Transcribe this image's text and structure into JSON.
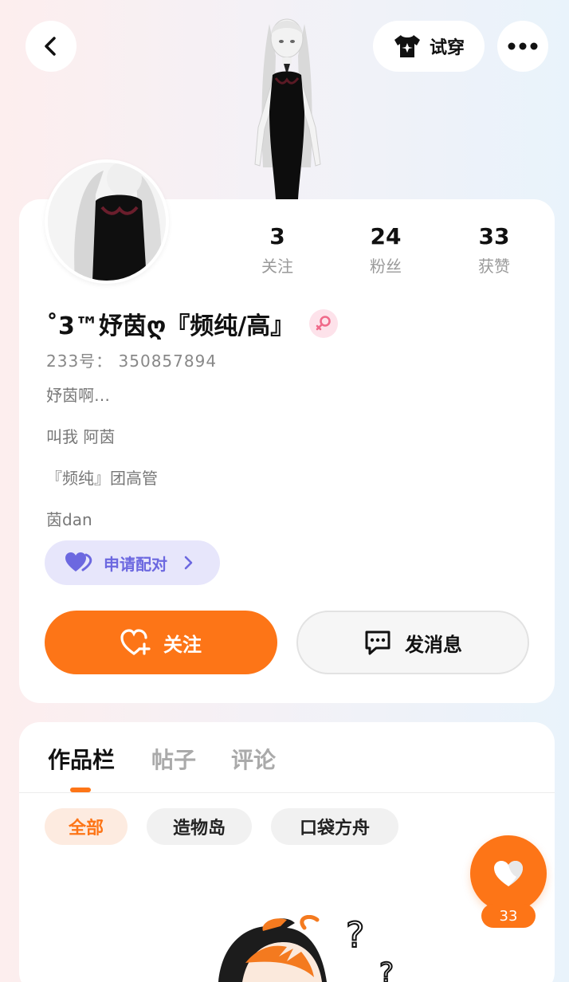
{
  "header": {
    "try_on_label": "试穿"
  },
  "profile": {
    "stats": [
      {
        "value": "3",
        "label": "关注"
      },
      {
        "value": "24",
        "label": "粉丝"
      },
      {
        "value": "33",
        "label": "获赞"
      }
    ],
    "nickname": "˚3™妤茵ღ『频纯/高』",
    "uid": "233号： 350857894",
    "bio_lines": [
      "妤茵啊…",
      "叫我  阿茵",
      "『频纯』团高管",
      "茵dan"
    ],
    "pair_label": "申请配对",
    "follow_label": "关注",
    "message_label": "发消息"
  },
  "works": {
    "tabs": [
      {
        "label": "作品栏",
        "active": true
      },
      {
        "label": "帖子",
        "active": false
      },
      {
        "label": "评论",
        "active": false
      }
    ],
    "chips": [
      {
        "label": "全部",
        "active": true
      },
      {
        "label": "造物岛",
        "active": false
      },
      {
        "label": "口袋方舟",
        "active": false
      }
    ]
  },
  "like": {
    "count": "33"
  },
  "colors": {
    "accent": "#fd7517",
    "pair_bg": "#e7e6fb",
    "pair_text": "#6c68e0",
    "gender_pink": "#f06a8a"
  },
  "icons": [
    "back-icon",
    "tshirt-icon",
    "more-icon",
    "female-icon",
    "heart-pair-icon",
    "chevron-right-icon",
    "heart-plus-icon",
    "chat-icon",
    "heart-icon"
  ]
}
